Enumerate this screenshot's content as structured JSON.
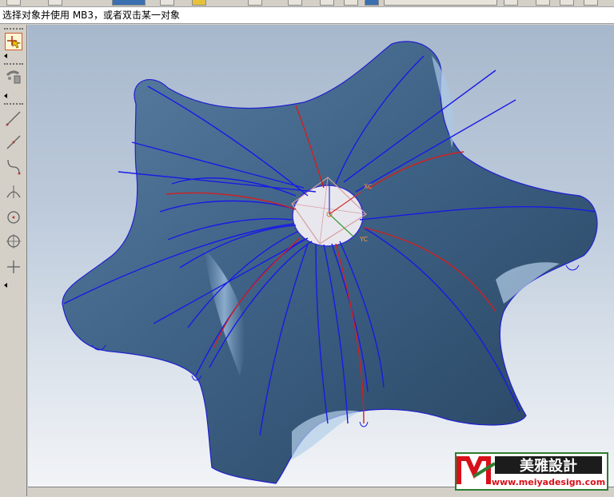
{
  "status": {
    "prompt": "选择对象并使用 MB3，或者双击某一对象"
  },
  "palette": {
    "tools": [
      {
        "icon": "select-cursor-icon"
      },
      {
        "icon": "roll-view-icon"
      },
      {
        "icon": "line-icon"
      },
      {
        "icon": "line-icon"
      },
      {
        "icon": "spline-icon"
      },
      {
        "icon": "arc-icon"
      },
      {
        "icon": "circle-icon"
      },
      {
        "icon": "circle-icon"
      },
      {
        "icon": "point-icon"
      }
    ]
  },
  "viewport": {
    "axis_labels": {
      "x": "XC",
      "y": "YC"
    }
  },
  "watermark": {
    "brand": "美雅設計",
    "url": "www.meiyadesign.com"
  },
  "colors": {
    "surface": "#3d5f80",
    "curve_blue": "#1a1ae6",
    "curve_red": "#d02020",
    "viewport_bg": "#bccadb",
    "brand_green": "#2e7d32"
  }
}
